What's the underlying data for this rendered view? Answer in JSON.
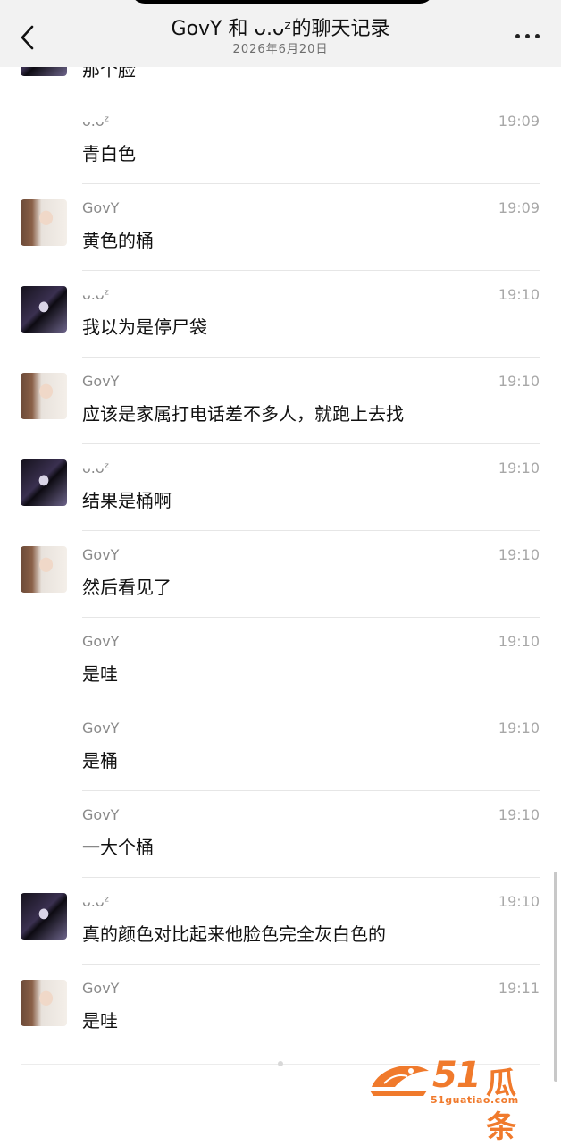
{
  "header": {
    "title": "GovY 和 ᴗ.ᴗᶻ的聊天记录",
    "date": "2026年6月20日"
  },
  "partial_top_text": "那个脸",
  "messages": [
    {
      "sender": "ᴗ.ᴗᶻ",
      "time": "19:09",
      "text": "青白色",
      "avatar": "none"
    },
    {
      "sender": "GovY",
      "time": "19:09",
      "text": "黄色的桶",
      "avatar": "govy"
    },
    {
      "sender": "ᴗ.ᴗᶻ",
      "time": "19:10",
      "text": "我以为是停尸袋",
      "avatar": "other"
    },
    {
      "sender": "GovY",
      "time": "19:10",
      "text": "应该是家属打电话差不多人，就跑上去找",
      "avatar": "govy"
    },
    {
      "sender": "ᴗ.ᴗᶻ",
      "time": "19:10",
      "text": "结果是桶啊",
      "avatar": "other"
    },
    {
      "sender": "GovY",
      "time": "19:10",
      "text": "然后看见了",
      "avatar": "govy"
    },
    {
      "sender": "GovY",
      "time": "19:10",
      "text": "是哇",
      "avatar": "none"
    },
    {
      "sender": "GovY",
      "time": "19:10",
      "text": "是桶",
      "avatar": "none"
    },
    {
      "sender": "GovY",
      "time": "19:10",
      "text": "一大个桶",
      "avatar": "none"
    },
    {
      "sender": "ᴗ.ᴗᶻ",
      "time": "19:10",
      "text": "真的颜色对比起来他脸色完全灰白色的",
      "avatar": "other"
    },
    {
      "sender": "GovY",
      "time": "19:11",
      "text": "是哇",
      "avatar": "govy"
    }
  ],
  "watermark": {
    "number": "51",
    "name": "瓜条",
    "url": "51guatiao.com"
  },
  "icons": {
    "back": "chevron-left-icon",
    "more": "more-dots-icon"
  }
}
